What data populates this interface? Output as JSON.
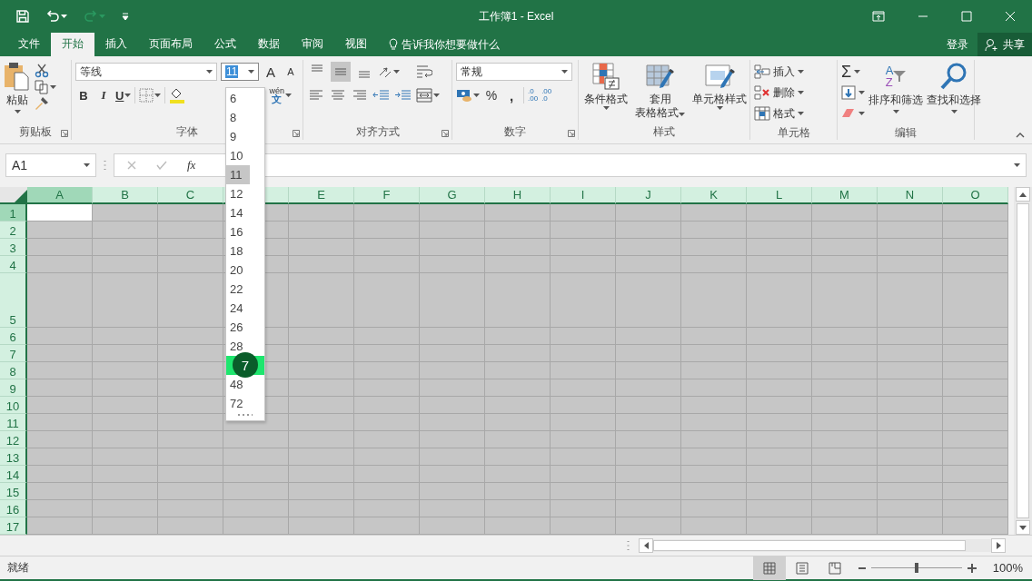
{
  "window": {
    "title": "工作簿1 - Excel"
  },
  "tabs": [
    {
      "label": "文件",
      "selected": false
    },
    {
      "label": "开始",
      "selected": true
    },
    {
      "label": "插入",
      "selected": false
    },
    {
      "label": "页面布局",
      "selected": false
    },
    {
      "label": "公式",
      "selected": false
    },
    {
      "label": "数据",
      "selected": false
    },
    {
      "label": "审阅",
      "selected": false
    },
    {
      "label": "视图",
      "selected": false
    }
  ],
  "tell_me": "告诉我你想要做什么",
  "account": {
    "sign_in": "登录",
    "share": "共享"
  },
  "ribbon": {
    "clipboard": {
      "paste": "粘贴",
      "label": "剪贴板",
      "launcher": true
    },
    "font": {
      "name": "等线",
      "size": "11",
      "bold": "B",
      "italic": "I",
      "underline": "U",
      "grow": "A",
      "shrink": "A",
      "phonetic_top": "wén",
      "phonetic_bottom": "文",
      "label": "字体",
      "launcher": true
    },
    "alignment": {
      "label": "对齐方式",
      "launcher": true,
      "vertical": [
        {
          "selected": false
        },
        {
          "selected": true
        },
        {
          "selected": false
        }
      ]
    },
    "number": {
      "format": "常规",
      "percent": "%",
      "comma": ",",
      "increase_decimal": [
        ".0",
        ".00"
      ],
      "decrease_decimal": [
        ".00",
        ".0"
      ],
      "label": "数字",
      "launcher": true
    },
    "styles": {
      "buttons": [
        {
          "lines": [
            "条件格式"
          ],
          "kind": "conditional"
        },
        {
          "lines": [
            "套用",
            "表格格式"
          ],
          "kind": "table"
        },
        {
          "lines": [
            "单元格样式"
          ],
          "kind": "cell"
        }
      ],
      "label": "样式",
      "launcher": false
    },
    "cells": {
      "buttons": [
        {
          "label": "插入",
          "kind": "insert"
        },
        {
          "label": "删除",
          "kind": "delete"
        },
        {
          "label": "格式",
          "kind": "format"
        }
      ],
      "label": "单元格",
      "launcher": false
    },
    "editing": {
      "sum": "Σ",
      "sort": {
        "label": "排序和筛选",
        "letters": [
          "A",
          "Z"
        ]
      },
      "find": "查找和选择",
      "label": "编辑",
      "launcher": false
    }
  },
  "formula_bar": {
    "name_box": "A1",
    "function": "fx"
  },
  "font_size_dropdown": {
    "items": [
      {
        "label": "6",
        "selected": false,
        "hovered": false
      },
      {
        "label": "8",
        "selected": false,
        "hovered": false
      },
      {
        "label": "9",
        "selected": false,
        "hovered": false
      },
      {
        "label": "10",
        "selected": false,
        "hovered": false
      },
      {
        "label": "11",
        "selected": true,
        "hovered": false
      },
      {
        "label": "12",
        "selected": false,
        "hovered": false
      },
      {
        "label": "14",
        "selected": false,
        "hovered": false
      },
      {
        "label": "16",
        "selected": false,
        "hovered": false
      },
      {
        "label": "18",
        "selected": false,
        "hovered": false
      },
      {
        "label": "20",
        "selected": false,
        "hovered": false
      },
      {
        "label": "22",
        "selected": false,
        "hovered": false
      },
      {
        "label": "24",
        "selected": false,
        "hovered": false
      },
      {
        "label": "26",
        "selected": false,
        "hovered": false
      },
      {
        "label": "28",
        "selected": false,
        "hovered": false
      },
      {
        "selected": false,
        "hovered": true,
        "step": "7"
      },
      {
        "label": "48",
        "selected": false,
        "hovered": false
      },
      {
        "label": "72",
        "selected": false,
        "hovered": false
      }
    ]
  },
  "sheet": {
    "columns": [
      {
        "label": "A",
        "active": true
      },
      {
        "label": "B",
        "active": false
      },
      {
        "label": "C",
        "active": false
      },
      {
        "active": false
      },
      {
        "label": "E",
        "active": false
      },
      {
        "label": "F",
        "active": false
      },
      {
        "label": "G",
        "active": false
      },
      {
        "label": "H",
        "active": false
      },
      {
        "label": "I",
        "active": false
      },
      {
        "label": "J",
        "active": false
      },
      {
        "label": "K",
        "active": false
      },
      {
        "label": "L",
        "active": false
      },
      {
        "label": "M",
        "active": false
      },
      {
        "label": "N",
        "active": false
      },
      {
        "label": "O",
        "active": false
      }
    ],
    "rows": [
      {
        "label": "1",
        "active": true,
        "kind": "normal"
      },
      {
        "label": "2",
        "active": false,
        "kind": "normal"
      },
      {
        "label": "3",
        "active": false,
        "kind": "normal"
      },
      {
        "label": "4",
        "active": false,
        "kind": "normal"
      },
      {
        "label": "5",
        "active": false,
        "kind": "tall"
      },
      {
        "label": "6",
        "active": false,
        "kind": "normal"
      },
      {
        "label": "7",
        "active": false,
        "kind": "normal"
      },
      {
        "label": "8",
        "active": false,
        "kind": "normal"
      },
      {
        "label": "9",
        "active": false,
        "kind": "normal"
      },
      {
        "label": "10",
        "active": false,
        "kind": "normal"
      },
      {
        "label": "11",
        "active": false,
        "kind": "normal"
      },
      {
        "label": "12",
        "active": false,
        "kind": "normal"
      },
      {
        "label": "13",
        "active": false,
        "kind": "normal"
      },
      {
        "label": "14",
        "active": false,
        "kind": "normal"
      },
      {
        "label": "15",
        "active": false,
        "kind": "normal"
      },
      {
        "label": "16",
        "active": false,
        "kind": "normal"
      },
      {
        "label": "17",
        "active": false,
        "kind": "normal"
      }
    ]
  },
  "status_bar": {
    "status": "就绪",
    "views": [
      {
        "kind": "normal",
        "selected": true
      },
      {
        "kind": "page_layout",
        "selected": false
      },
      {
        "kind": "page_break",
        "selected": false
      }
    ],
    "zoom": {
      "level": 0.5,
      "reading": "100%"
    }
  }
}
